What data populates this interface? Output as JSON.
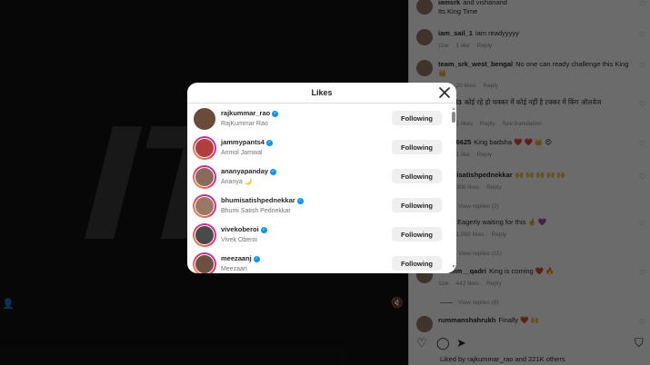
{
  "post": {
    "big_text": "IT"
  },
  "comments": [
    {
      "user": "iamsrk",
      "text": "and vishanand",
      "sub": "Its King Time"
    },
    {
      "user": "iam_sail_1",
      "text": "iam readyyyyy",
      "meta": [
        "11w",
        "1 like",
        "Reply"
      ]
    },
    {
      "user": "team_srk_west_bengal",
      "text": "No one can ready challenge this King",
      "sub": "👑",
      "meta": [
        "11w",
        "20 likes",
        "Reply"
      ]
    },
    {
      "user": "kappil3",
      "text": "कोई रहे हो चक्कर में कोई नहीं है टक्कर में किंग ऑलवेज",
      "sub": "👑",
      "meta": [
        "11w",
        "2 likes",
        "Reply",
        "See translation"
      ]
    },
    {
      "user": "sakar6625",
      "text": "King badsha ❤️ ❤️ 👑 😍",
      "meta": [
        "11w",
        "1 like",
        "Reply"
      ]
    },
    {
      "user": "bhumisatishpednekkar",
      "text": "🙌 🙌 🙌 🙌 🙌",
      "meta": [
        "11w",
        "398 likes",
        "Reply"
      ],
      "view_replies": "View replies (2)"
    },
    {
      "user": "mers",
      "text": "Eagerly waiting for this 🤞 💜",
      "meta": [
        "11w",
        "1,069 likes",
        "Reply"
      ],
      "view_replies": "View replies (11)"
    },
    {
      "user": "muslim__qadri",
      "text": "King is coming ❤️ 🔥",
      "meta": [
        "11w",
        "442 likes",
        "Reply"
      ],
      "view_replies": "View replies (8)"
    },
    {
      "user": "rummanshahrukh",
      "text": "Finally ❤️ 🙌"
    }
  ],
  "liked_by": "Liked by rajkummar_rao and 221K others",
  "modal": {
    "title": "Likes",
    "rows": [
      {
        "username": "rajkummar_rao",
        "fullname": "RajKummar Rao",
        "button": "Following",
        "story": false,
        "avatar_color": "#6b4a3a"
      },
      {
        "username": "jammypants4",
        "fullname": "Anmol Jamwal",
        "button": "Following",
        "story": true,
        "avatar_color": "#b04040"
      },
      {
        "username": "ananyapanday",
        "fullname": "Ananya 🌙",
        "button": "Following",
        "story": true,
        "avatar_color": "#8a6a5a"
      },
      {
        "username": "bhumisatishpednekkar",
        "fullname": "Bhumi Satish Pednekkar",
        "button": "Following",
        "story": true,
        "avatar_color": "#9a7866"
      },
      {
        "username": "vivekoberoi",
        "fullname": "Vivek Oberoi",
        "button": "Following",
        "story": true,
        "avatar_color": "#4a4a4a"
      },
      {
        "username": "meezaanj",
        "fullname": "Meezaan",
        "button": "Following",
        "story": true,
        "avatar_color": "#6e5040"
      }
    ]
  },
  "icons": [
    "close-icon",
    "verified-icon",
    "heart-icon",
    "comment-icon",
    "share-icon",
    "bookmark-icon",
    "person-icon",
    "mute-icon"
  ]
}
